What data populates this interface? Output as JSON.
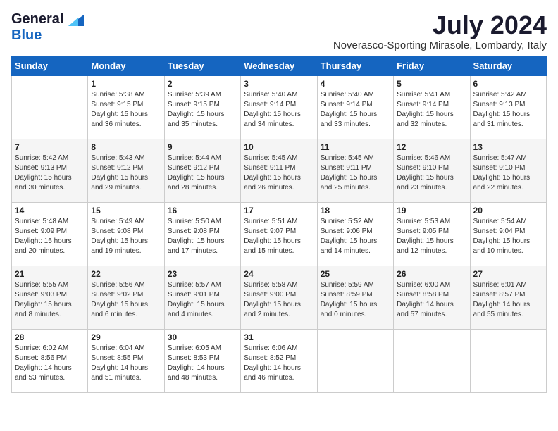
{
  "logo": {
    "general": "General",
    "blue": "Blue"
  },
  "title": {
    "month_year": "July 2024",
    "location": "Noverasco-Sporting Mirasole, Lombardy, Italy"
  },
  "weekdays": [
    "Sunday",
    "Monday",
    "Tuesday",
    "Wednesday",
    "Thursday",
    "Friday",
    "Saturday"
  ],
  "weeks": [
    [
      {
        "day": "",
        "sunrise": "",
        "sunset": "",
        "daylight": ""
      },
      {
        "day": "1",
        "sunrise": "Sunrise: 5:38 AM",
        "sunset": "Sunset: 9:15 PM",
        "daylight": "Daylight: 15 hours and 36 minutes."
      },
      {
        "day": "2",
        "sunrise": "Sunrise: 5:39 AM",
        "sunset": "Sunset: 9:15 PM",
        "daylight": "Daylight: 15 hours and 35 minutes."
      },
      {
        "day": "3",
        "sunrise": "Sunrise: 5:40 AM",
        "sunset": "Sunset: 9:14 PM",
        "daylight": "Daylight: 15 hours and 34 minutes."
      },
      {
        "day": "4",
        "sunrise": "Sunrise: 5:40 AM",
        "sunset": "Sunset: 9:14 PM",
        "daylight": "Daylight: 15 hours and 33 minutes."
      },
      {
        "day": "5",
        "sunrise": "Sunrise: 5:41 AM",
        "sunset": "Sunset: 9:14 PM",
        "daylight": "Daylight: 15 hours and 32 minutes."
      },
      {
        "day": "6",
        "sunrise": "Sunrise: 5:42 AM",
        "sunset": "Sunset: 9:13 PM",
        "daylight": "Daylight: 15 hours and 31 minutes."
      }
    ],
    [
      {
        "day": "7",
        "sunrise": "Sunrise: 5:42 AM",
        "sunset": "Sunset: 9:13 PM",
        "daylight": "Daylight: 15 hours and 30 minutes."
      },
      {
        "day": "8",
        "sunrise": "Sunrise: 5:43 AM",
        "sunset": "Sunset: 9:12 PM",
        "daylight": "Daylight: 15 hours and 29 minutes."
      },
      {
        "day": "9",
        "sunrise": "Sunrise: 5:44 AM",
        "sunset": "Sunset: 9:12 PM",
        "daylight": "Daylight: 15 hours and 28 minutes."
      },
      {
        "day": "10",
        "sunrise": "Sunrise: 5:45 AM",
        "sunset": "Sunset: 9:11 PM",
        "daylight": "Daylight: 15 hours and 26 minutes."
      },
      {
        "day": "11",
        "sunrise": "Sunrise: 5:45 AM",
        "sunset": "Sunset: 9:11 PM",
        "daylight": "Daylight: 15 hours and 25 minutes."
      },
      {
        "day": "12",
        "sunrise": "Sunrise: 5:46 AM",
        "sunset": "Sunset: 9:10 PM",
        "daylight": "Daylight: 15 hours and 23 minutes."
      },
      {
        "day": "13",
        "sunrise": "Sunrise: 5:47 AM",
        "sunset": "Sunset: 9:10 PM",
        "daylight": "Daylight: 15 hours and 22 minutes."
      }
    ],
    [
      {
        "day": "14",
        "sunrise": "Sunrise: 5:48 AM",
        "sunset": "Sunset: 9:09 PM",
        "daylight": "Daylight: 15 hours and 20 minutes."
      },
      {
        "day": "15",
        "sunrise": "Sunrise: 5:49 AM",
        "sunset": "Sunset: 9:08 PM",
        "daylight": "Daylight: 15 hours and 19 minutes."
      },
      {
        "day": "16",
        "sunrise": "Sunrise: 5:50 AM",
        "sunset": "Sunset: 9:08 PM",
        "daylight": "Daylight: 15 hours and 17 minutes."
      },
      {
        "day": "17",
        "sunrise": "Sunrise: 5:51 AM",
        "sunset": "Sunset: 9:07 PM",
        "daylight": "Daylight: 15 hours and 15 minutes."
      },
      {
        "day": "18",
        "sunrise": "Sunrise: 5:52 AM",
        "sunset": "Sunset: 9:06 PM",
        "daylight": "Daylight: 15 hours and 14 minutes."
      },
      {
        "day": "19",
        "sunrise": "Sunrise: 5:53 AM",
        "sunset": "Sunset: 9:05 PM",
        "daylight": "Daylight: 15 hours and 12 minutes."
      },
      {
        "day": "20",
        "sunrise": "Sunrise: 5:54 AM",
        "sunset": "Sunset: 9:04 PM",
        "daylight": "Daylight: 15 hours and 10 minutes."
      }
    ],
    [
      {
        "day": "21",
        "sunrise": "Sunrise: 5:55 AM",
        "sunset": "Sunset: 9:03 PM",
        "daylight": "Daylight: 15 hours and 8 minutes."
      },
      {
        "day": "22",
        "sunrise": "Sunrise: 5:56 AM",
        "sunset": "Sunset: 9:02 PM",
        "daylight": "Daylight: 15 hours and 6 minutes."
      },
      {
        "day": "23",
        "sunrise": "Sunrise: 5:57 AM",
        "sunset": "Sunset: 9:01 PM",
        "daylight": "Daylight: 15 hours and 4 minutes."
      },
      {
        "day": "24",
        "sunrise": "Sunrise: 5:58 AM",
        "sunset": "Sunset: 9:00 PM",
        "daylight": "Daylight: 15 hours and 2 minutes."
      },
      {
        "day": "25",
        "sunrise": "Sunrise: 5:59 AM",
        "sunset": "Sunset: 8:59 PM",
        "daylight": "Daylight: 15 hours and 0 minutes."
      },
      {
        "day": "26",
        "sunrise": "Sunrise: 6:00 AM",
        "sunset": "Sunset: 8:58 PM",
        "daylight": "Daylight: 14 hours and 57 minutes."
      },
      {
        "day": "27",
        "sunrise": "Sunrise: 6:01 AM",
        "sunset": "Sunset: 8:57 PM",
        "daylight": "Daylight: 14 hours and 55 minutes."
      }
    ],
    [
      {
        "day": "28",
        "sunrise": "Sunrise: 6:02 AM",
        "sunset": "Sunset: 8:56 PM",
        "daylight": "Daylight: 14 hours and 53 minutes."
      },
      {
        "day": "29",
        "sunrise": "Sunrise: 6:04 AM",
        "sunset": "Sunset: 8:55 PM",
        "daylight": "Daylight: 14 hours and 51 minutes."
      },
      {
        "day": "30",
        "sunrise": "Sunrise: 6:05 AM",
        "sunset": "Sunset: 8:53 PM",
        "daylight": "Daylight: 14 hours and 48 minutes."
      },
      {
        "day": "31",
        "sunrise": "Sunrise: 6:06 AM",
        "sunset": "Sunset: 8:52 PM",
        "daylight": "Daylight: 14 hours and 46 minutes."
      },
      {
        "day": "",
        "sunrise": "",
        "sunset": "",
        "daylight": ""
      },
      {
        "day": "",
        "sunrise": "",
        "sunset": "",
        "daylight": ""
      },
      {
        "day": "",
        "sunrise": "",
        "sunset": "",
        "daylight": ""
      }
    ]
  ]
}
